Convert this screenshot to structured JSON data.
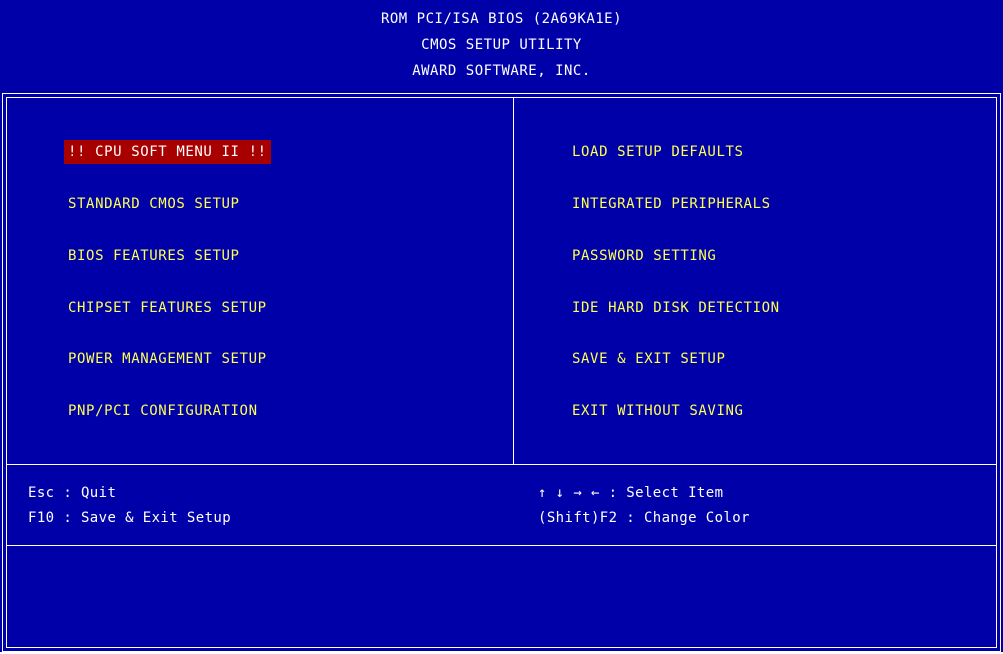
{
  "header": {
    "line1": "ROM PCI/ISA BIOS (2A69KA1E)",
    "line2": "CMOS SETUP UTILITY",
    "line3": "AWARD SOFTWARE, INC."
  },
  "colors": {
    "background": "#0000a8",
    "menu_text": "#ffff54",
    "selected_background": "#a80000",
    "frame": "#ffffff"
  },
  "menu": {
    "left": [
      {
        "label": "!! CPU SOFT MENU II !!",
        "selected": true
      },
      {
        "label": "STANDARD CMOS SETUP",
        "selected": false
      },
      {
        "label": "BIOS FEATURES SETUP",
        "selected": false
      },
      {
        "label": "CHIPSET FEATURES SETUP",
        "selected": false
      },
      {
        "label": "POWER MANAGEMENT SETUP",
        "selected": false
      },
      {
        "label": "PNP/PCI CONFIGURATION",
        "selected": false
      }
    ],
    "right": [
      {
        "label": "LOAD SETUP DEFAULTS",
        "selected": false
      },
      {
        "label": "INTEGRATED PERIPHERALS",
        "selected": false
      },
      {
        "label": "PASSWORD SETTING",
        "selected": false
      },
      {
        "label": "IDE HARD DISK DETECTION",
        "selected": false
      },
      {
        "label": "SAVE & EXIT SETUP",
        "selected": false
      },
      {
        "label": "EXIT WITHOUT SAVING",
        "selected": false
      }
    ]
  },
  "help": {
    "esc": "Esc : Quit",
    "f10": "F10 : Save & Exit Setup",
    "arrows": "↑ ↓ → ←   : Select Item",
    "shift_f2": "(Shift)F2 : Change Color"
  },
  "description": ""
}
